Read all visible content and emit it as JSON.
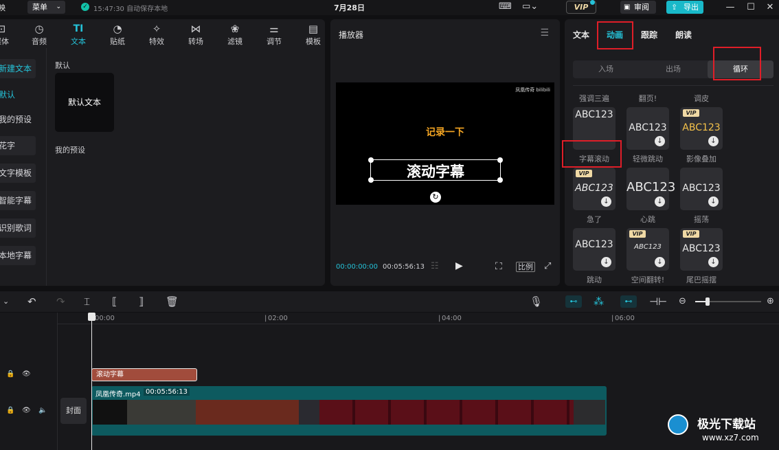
{
  "topbar": {
    "app_name": "剪映",
    "menu": "菜单",
    "save_status": "15:47:30 自动保存本地",
    "date": "7月28日",
    "vip": "VIP",
    "review": "审阅",
    "export": "导出"
  },
  "toolbar": [
    {
      "label": "媒体",
      "icon": "media-icon"
    },
    {
      "label": "音频",
      "icon": "audio-icon"
    },
    {
      "label": "文本",
      "icon": "text-icon",
      "active": true
    },
    {
      "label": "贴纸",
      "icon": "sticker-icon"
    },
    {
      "label": "特效",
      "icon": "effect-icon"
    },
    {
      "label": "转场",
      "icon": "transition-icon"
    },
    {
      "label": "滤镜",
      "icon": "filter-icon"
    },
    {
      "label": "调节",
      "icon": "adjust-icon"
    },
    {
      "label": "模板",
      "icon": "template-icon"
    }
  ],
  "sidebar": [
    "新建文本",
    "默认",
    "我的预设",
    "花字",
    "文字模板",
    "智能字幕",
    "识别歌词",
    "本地字幕"
  ],
  "library": {
    "section_default": "默认",
    "default_card": "默认文本",
    "section_preset": "我的预设"
  },
  "player": {
    "title": "播放器",
    "watermark": "凤凰传奇 bilibili",
    "headline": "记录一下",
    "subtitle": "滚动字幕",
    "time_current": "00:00:00:00",
    "time_total": "00:05:56:13",
    "ratio": "比例"
  },
  "right_panel": {
    "tabs": [
      "文本",
      "动画",
      "跟踪",
      "朗读"
    ],
    "active_tab": "动画",
    "segments": [
      "入场",
      "出场",
      "循环"
    ],
    "active_segment": "循环",
    "top_labels": [
      "强调三遍",
      "翻页!",
      "调皮"
    ],
    "animations": [
      {
        "name": "字幕滚动",
        "preview": "ABC123",
        "vip": false,
        "download": false
      },
      {
        "name": "轻微跳动",
        "preview": "ABC123",
        "vip": false,
        "download": true
      },
      {
        "name": "影像叠加",
        "preview": "ABC123",
        "vip": true,
        "download": true
      },
      {
        "name": "急了",
        "preview": "ABC123",
        "vip": true,
        "download": true
      },
      {
        "name": "心跳",
        "preview": "ABC123",
        "vip": false,
        "download": true
      },
      {
        "name": "摇荡",
        "preview": "ABC123",
        "vip": false,
        "download": true
      },
      {
        "name": "跳动",
        "preview": "ABC123",
        "vip": false,
        "download": true
      },
      {
        "name": "空间翻转!",
        "preview": "ABC123",
        "vip": true,
        "download": true
      },
      {
        "name": "尾巴摇摆",
        "preview": "ABC123",
        "vip": true,
        "download": true
      }
    ]
  },
  "timeline": {
    "ruler": [
      "00:00",
      "02:00",
      "04:00",
      "06:00"
    ],
    "text_clip": "滚动字幕",
    "video_clip_name": "凤凰传奇.mp4",
    "video_clip_duration": "00:05:56:13",
    "cover": "封面"
  },
  "watermark": {
    "site": "极光下载站",
    "url": "www.xz7.com"
  },
  "colors": {
    "accent": "#25c2d8",
    "highlight": "#e01e28",
    "text_clip": "#a14c3c",
    "video_clip": "#0d5a5f"
  }
}
